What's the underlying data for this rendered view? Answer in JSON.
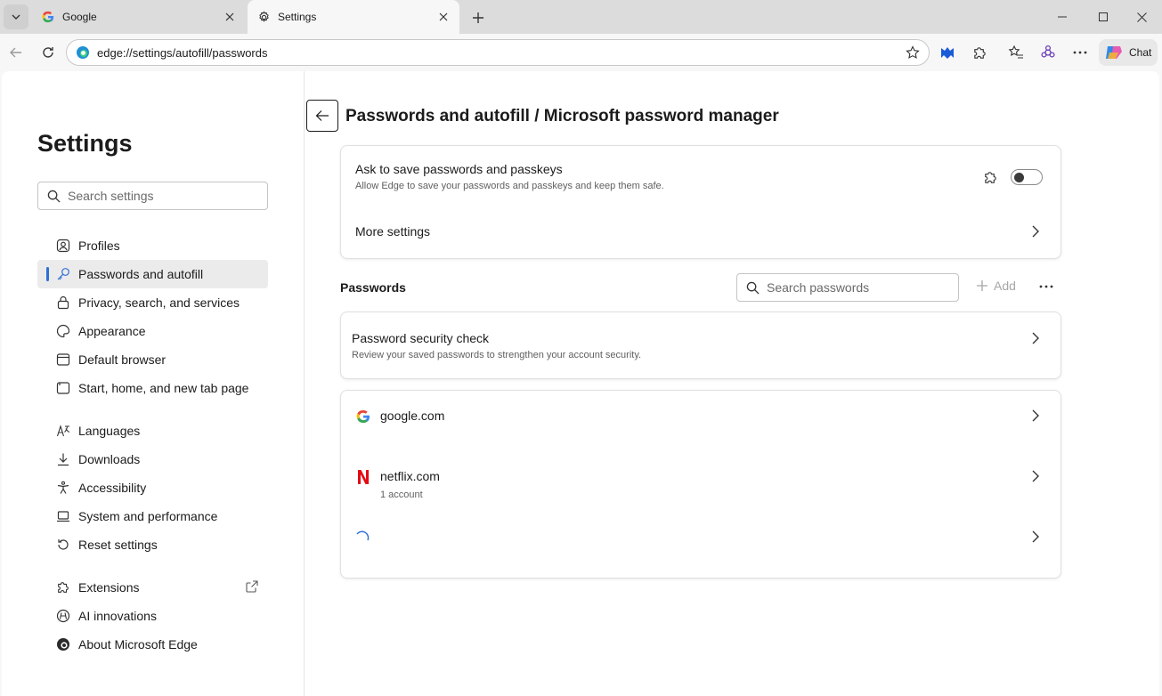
{
  "tabs": [
    {
      "title": "Google",
      "icon": "google-g-icon"
    },
    {
      "title": "Settings",
      "icon": "gear-icon"
    }
  ],
  "address_bar": {
    "url": "edge://settings/autofill/passwords"
  },
  "toolbar": {
    "chat_label": "Chat"
  },
  "sidebar": {
    "title": "Settings",
    "search_placeholder": "Search settings",
    "items": [
      {
        "label": "Profiles",
        "icon": "profile-icon"
      },
      {
        "label": "Passwords and autofill",
        "icon": "key-icon",
        "active": true
      },
      {
        "label": "Privacy, search, and services",
        "icon": "lock-icon"
      },
      {
        "label": "Appearance",
        "icon": "palette-icon"
      },
      {
        "label": "Default browser",
        "icon": "browser-icon"
      },
      {
        "label": "Start, home, and new tab page",
        "icon": "home-icon"
      },
      {
        "label": "Languages",
        "icon": "languages-icon"
      },
      {
        "label": "Downloads",
        "icon": "download-icon"
      },
      {
        "label": "Accessibility",
        "icon": "accessibility-icon"
      },
      {
        "label": "System and performance",
        "icon": "laptop-icon"
      },
      {
        "label": "Reset settings",
        "icon": "reset-icon"
      },
      {
        "label": "Extensions",
        "icon": "puzzle-icon"
      },
      {
        "label": "AI innovations",
        "icon": "ai-icon"
      },
      {
        "label": "About Microsoft Edge",
        "icon": "edge-icon"
      }
    ]
  },
  "main": {
    "title": "Passwords and autofill / Microsoft password manager",
    "save_setting": {
      "title": "Ask to save passwords and passkeys",
      "subtitle": "Allow Edge to save your passwords and passkeys and keep them safe.",
      "enabled": false
    },
    "more_settings": "More settings",
    "passwords_label": "Passwords",
    "search_placeholder": "Search passwords",
    "add_label": "Add",
    "security_check": {
      "title": "Password security check",
      "subtitle": "Review your saved passwords to strengthen your account security."
    },
    "sites": [
      {
        "name": "google.com",
        "sub": "",
        "icon": "google-g-icon"
      },
      {
        "name": "netflix.com",
        "sub": "1 account",
        "icon": "netflix-icon"
      },
      {
        "name": "",
        "sub": "",
        "icon": "loading-spinner-icon"
      }
    ]
  },
  "colors": {
    "accent": "#2f6fd6",
    "netflix": "#e50914"
  }
}
